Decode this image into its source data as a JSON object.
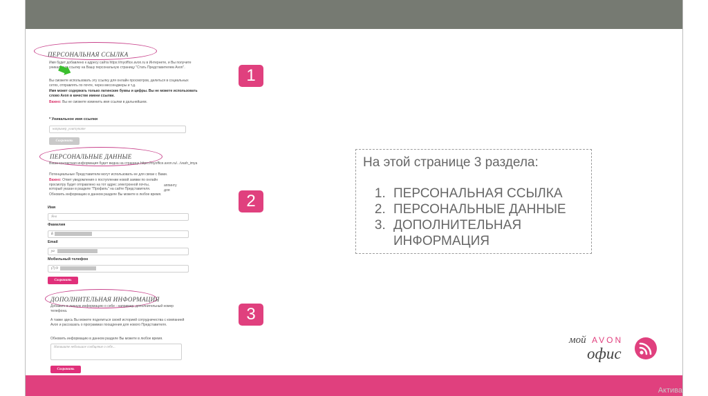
{
  "sections": {
    "s1": {
      "title": "ПЕРСОНАЛЬНАЯ ССЫЛКА",
      "p1": "Имя будет добавлено к адресу сайта https://myoffice.avon.ru в Интернете, и Вы получите уникальную ссылку на Вашу персональную страницу \"Стать Представителем Avon\".",
      "p2": "Вы сможете использовать эту ссылку для онлайн просмотров, делиться в социальных сетях, отправлять по почте, через мессенджеры и т.д.",
      "p3": "Имя может содержать только латинские буквы и цифры. Вы не можете использовать слово Avon в качестве имени ссылки.",
      "warn_label": "Важно:",
      "warn_text": "Вы не сможете изменить имя ссылки в дальнейшем.",
      "field_label": "* Уникальное имя ссылки",
      "field_placeholder": "например_yournyname",
      "save_label": "Сохранить"
    },
    "s2": {
      "title": "ПЕРСОНАЛЬНЫЕ ДАННЫЕ",
      "p1": "Ваша контактная информация будет видна на странице https://myoffice.avon.ru/.../vash_imya",
      "p2": "Потенциальные Представители могут использовать ее для связи с Вами.",
      "warn_label": "Важно:",
      "warn_text": "Ответ уведомления о поступлении новой заявки по онлайн просмотру будет отправлено на тот адрес электронной почты, который указан в разделе \"Профиль\" на сайте Представителя.",
      "side_text": "аппинту для",
      "p3": "Обновить информацию в данном разделе Вы можете в любое время.",
      "name_label": "Имя",
      "name_value": "Яна",
      "surname_label": "Фамилия",
      "surname_value": "Б",
      "email_label": "Email",
      "email_value": "ya",
      "phone_label": "Мобильный телефон",
      "phone_value": "(7) 9",
      "save_label": "Сохранить"
    },
    "s3": {
      "title": "ДОПОЛНИТЕЛЬНАЯ ИНФОРМАЦИЯ",
      "p1": "Добавьте в личную информацию о себе - например, дополнительный номер телефона.",
      "p2": "А также здесь Вы можете поделиться своей историей сотрудничества с компанией Avon и рассказать о программах поощрения для нового Представителя.",
      "p3": "Обновить информацию в данном разделе Вы можете в любое время.",
      "textarea_placeholder": "Напишите небольшое сообщение о себе...",
      "save_label": "Сохранить"
    }
  },
  "badges": [
    "1",
    "2",
    "3"
  ],
  "infobox": {
    "heading": "На этой странице 3 раздела:",
    "items": [
      "ПЕРСОНАЛЬНАЯ ССЫЛКА",
      "ПЕРСОНАЛЬНЫЕ ДАННЫЕ",
      "ДОПОЛНИТЕЛЬНАЯ ИНФОРМАЦИЯ"
    ]
  },
  "logo": {
    "moi": "мой",
    "avon": "AVON",
    "ofis": "офис"
  },
  "watermark": "Актива",
  "colors": {
    "accent": "#e0407e",
    "topbar": "#767a72",
    "text": "#666666"
  }
}
